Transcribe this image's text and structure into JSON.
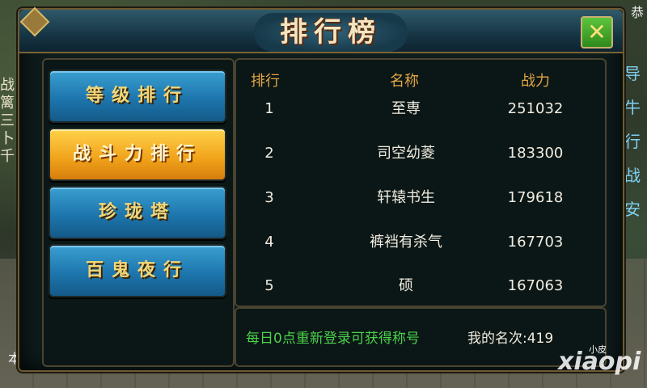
{
  "dialog": {
    "title": "排行榜",
    "close_symbol": "✕"
  },
  "tabs": [
    {
      "label": "等级排行",
      "active": false
    },
    {
      "label": "战斗力排行",
      "active": true
    },
    {
      "label": "珍珑塔",
      "active": false
    },
    {
      "label": "百鬼夜行",
      "active": false
    }
  ],
  "table": {
    "headers": {
      "rank": "排行",
      "name": "名称",
      "power": "战力"
    },
    "rows": [
      {
        "rank": "1",
        "name": "至専",
        "power": "251032"
      },
      {
        "rank": "2",
        "name": "司空幼菱",
        "power": "183300"
      },
      {
        "rank": "3",
        "name": "轩辕书生",
        "power": "179618"
      },
      {
        "rank": "4",
        "name": "裤裆有杀气",
        "power": "167703"
      },
      {
        "rank": "5",
        "name": "硕",
        "power": "167063"
      }
    ]
  },
  "info": {
    "tip": "每日0点重新登录可获得称号",
    "my_rank_label": "我的名次:",
    "my_rank_value": "419"
  },
  "background": {
    "left_text": "战 篱 三 卜 千",
    "right_text": "导 牛 行 战 安",
    "top_right": "恭",
    "bottom_left": "本"
  },
  "watermark": {
    "main": "xiaopi",
    "small": "小皮"
  },
  "colors": {
    "accent_gold": "#e2a645",
    "tip_green": "#4bd24b",
    "tab_blue": "#1d76ad",
    "tab_active_orange": "#f0a21a"
  },
  "icons": {
    "close": "close-icon",
    "corner": "corner-ornament-icon"
  }
}
